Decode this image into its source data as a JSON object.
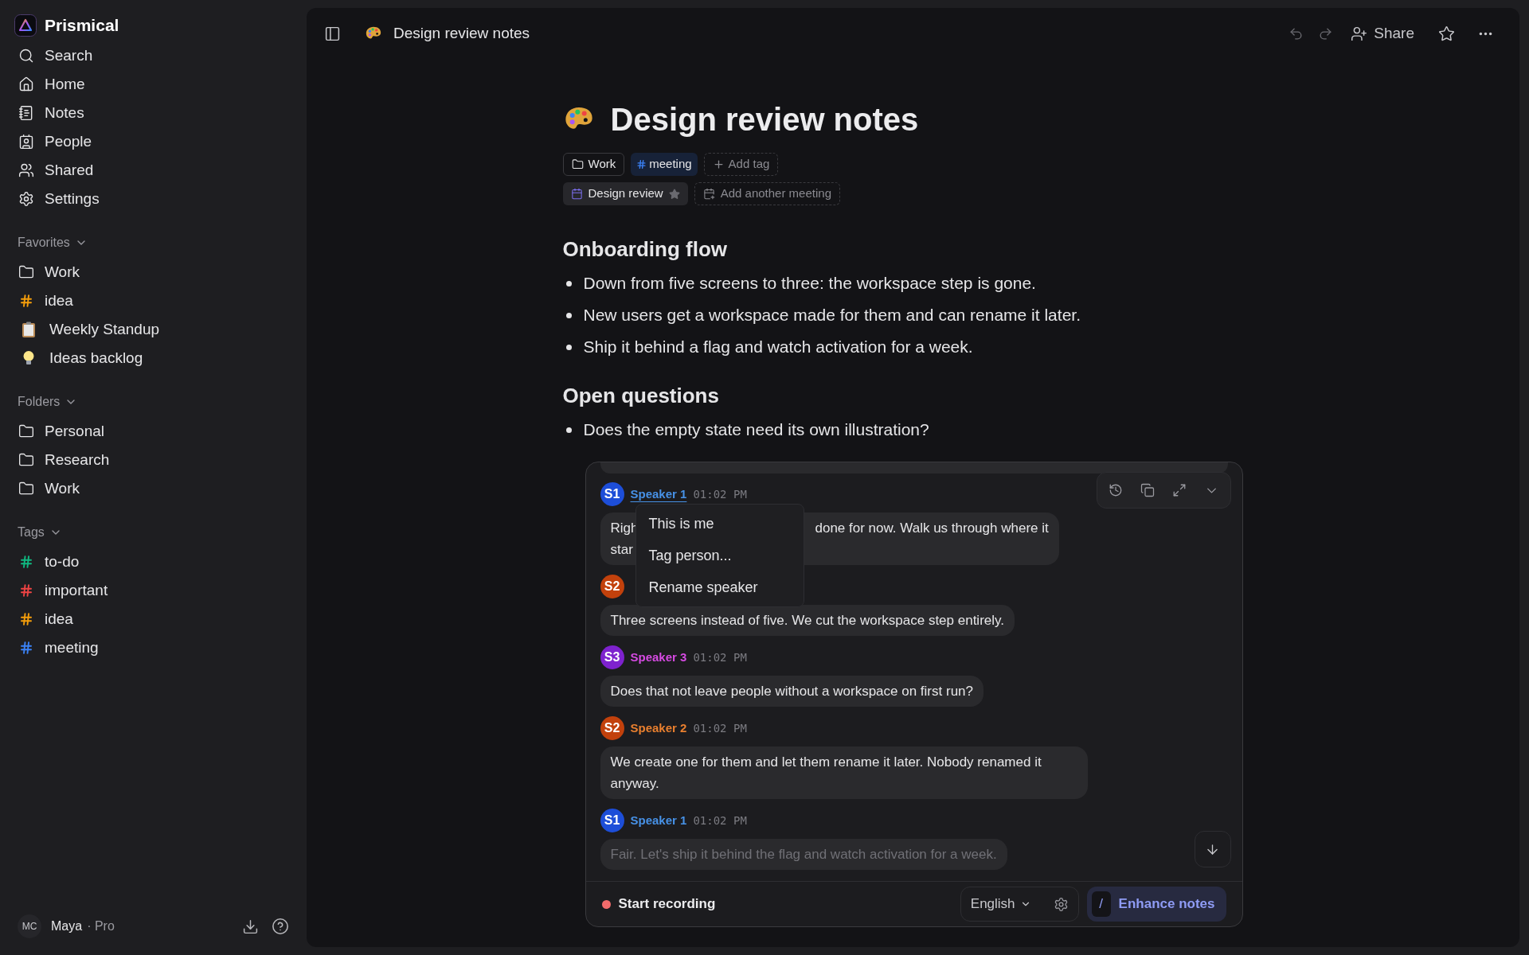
{
  "app": {
    "name": "Prismical"
  },
  "nav": [
    {
      "label": "Search",
      "kind": "search"
    },
    {
      "label": "Home",
      "kind": "home"
    },
    {
      "label": "Notes",
      "kind": "notes"
    },
    {
      "label": "People",
      "kind": "people"
    },
    {
      "label": "Shared",
      "kind": "shared"
    },
    {
      "label": "Settings",
      "kind": "settings"
    }
  ],
  "favorites": {
    "label": "Favorites",
    "items": [
      {
        "label": "Work",
        "kind": "folder"
      },
      {
        "label": "idea",
        "kind": "tag",
        "color": "#f59e0b"
      },
      {
        "label": "Weekly Standup",
        "kind": "clipboard"
      },
      {
        "label": "Ideas backlog",
        "kind": "bulb"
      }
    ]
  },
  "folders": {
    "label": "Folders",
    "items": [
      {
        "label": "Personal"
      },
      {
        "label": "Research"
      },
      {
        "label": "Work"
      }
    ]
  },
  "tags": {
    "label": "Tags",
    "items": [
      {
        "label": "to-do",
        "color": "#10b981"
      },
      {
        "label": "important",
        "color": "#ef4444"
      },
      {
        "label": "idea",
        "color": "#f59e0b"
      },
      {
        "label": "meeting",
        "color": "#3b82f6"
      }
    ]
  },
  "account": {
    "initials": "MC",
    "name": "Maya",
    "plan": "· Pro"
  },
  "topbar": {
    "title": "Design review notes",
    "share": "Share"
  },
  "document": {
    "title": "Design review notes",
    "folder_chip": "Work",
    "tag_chip": "meeting",
    "add_tag": "Add tag",
    "meeting_chip": "Design review",
    "add_meeting": "Add another meeting",
    "sections": [
      {
        "heading": "Onboarding flow",
        "bullets": [
          "Down from five screens to three: the workspace step is gone.",
          "New users get a workspace made for them and can rename it later.",
          "Ship it behind a flag and watch activation for a week."
        ]
      },
      {
        "heading": "Open questions",
        "bullets": [
          "Does the empty state need its own illustration?"
        ]
      }
    ]
  },
  "transcript": {
    "messages": [
      {
        "kind": "covered",
        "avatar": "S1",
        "speaker": "Speaker 1",
        "time": "01:02 PM",
        "color": "#1d4ed8",
        "faded": false,
        "lines": [
          [
            "Righ",
            "done for now. Walk us through where it"
          ],
          [
            "star"
          ]
        ],
        "menu": {
          "items": [
            "This is me",
            "Tag person...",
            "Rename speaker"
          ]
        }
      },
      {
        "kind": "plain",
        "avatar": "S2",
        "color": "#c2410c",
        "faded": false,
        "text": "Three screens instead of five. We cut the workspace step entirely."
      },
      {
        "kind": "plain",
        "avatar": "S3",
        "speaker": "Speaker 3",
        "time": "01:02 PM",
        "color": "#7e22ce",
        "faded": false,
        "text": "Does that not leave people without a workspace on first run?"
      },
      {
        "kind": "plain",
        "avatar": "S2",
        "speaker": "Speaker 2",
        "time": "01:02 PM",
        "color": "#c2410c",
        "faded": false,
        "text": "We create one for them and let them rename it later. Nobody renamed it anyway."
      },
      {
        "kind": "plain",
        "avatar": "S1",
        "speaker": "Speaker 1",
        "time": "01:02 PM",
        "color": "#1d4ed8",
        "faded": true,
        "text": "Fair. Let's ship it behind the flag and watch activation for a week."
      }
    ],
    "footer": {
      "record": "Start recording",
      "language": "English",
      "enhance_key": "/",
      "enhance": "Enhance notes"
    }
  }
}
